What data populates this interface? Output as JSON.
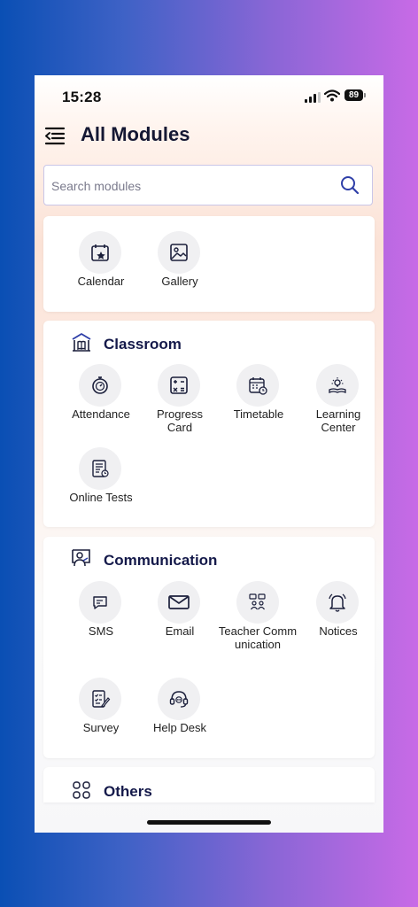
{
  "status": {
    "time": "15:28",
    "battery": "89"
  },
  "header": {
    "title": "All Modules"
  },
  "search": {
    "placeholder": "Search modules"
  },
  "general": {
    "items": [
      {
        "label": "Calendar",
        "icon": "calendar-star-icon"
      },
      {
        "label": "Gallery",
        "icon": "image-icon"
      }
    ]
  },
  "classroom": {
    "title": "Classroom",
    "icon": "classroom-building-icon",
    "items": [
      {
        "label": "Attendance",
        "icon": "stopwatch-icon"
      },
      {
        "label": "Progress Card",
        "icon": "calculator-icon"
      },
      {
        "label": "Timetable",
        "icon": "calendar-clock-icon"
      },
      {
        "label": "Learning Center",
        "icon": "book-lightbulb-icon"
      },
      {
        "label": "Online Tests",
        "icon": "test-sheet-icon"
      }
    ]
  },
  "communication": {
    "title": "Communication",
    "icon": "presenter-board-icon",
    "items": [
      {
        "label": "SMS",
        "icon": "chat-bubble-icon"
      },
      {
        "label": "Email",
        "icon": "envelope-icon"
      },
      {
        "label": "Teacher Communication",
        "icon": "teacher-communication-icon"
      },
      {
        "label": "Notices",
        "icon": "bell-icon"
      },
      {
        "label": "Survey",
        "icon": "survey-checklist-icon"
      },
      {
        "label": "Help Desk",
        "icon": "headset-icon"
      }
    ]
  },
  "others": {
    "title": "Others",
    "icon": "grid-icon"
  },
  "colors": {
    "title": "#14194a",
    "accent": "#2f3fa8",
    "icon_bg": "#f0f0f2",
    "background_left": "#0a4fb4",
    "background_right": "#c86ae6"
  }
}
